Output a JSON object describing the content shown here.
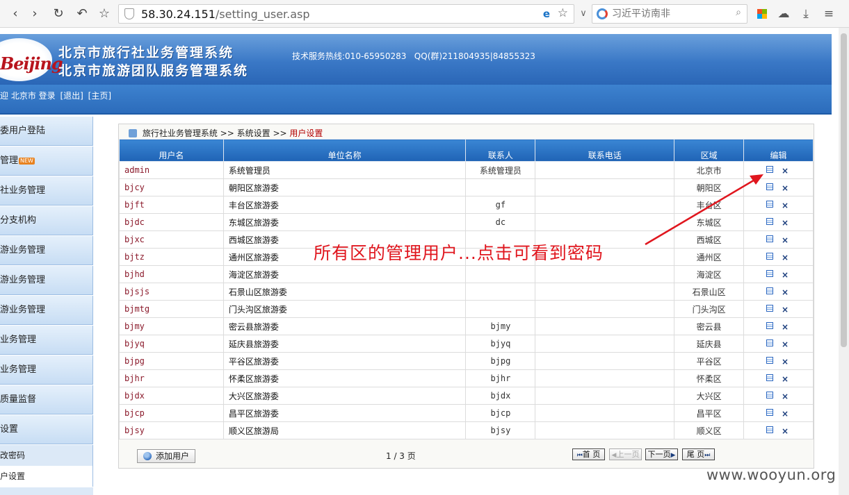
{
  "browser": {
    "url_host": "58.30.24.151",
    "url_path": "/setting_user.asp",
    "search_placeholder": "习近平访南非"
  },
  "header": {
    "logo": "Beijing",
    "title_line1": "北京市旅行社业务管理系统",
    "title_line2": "北京市旅游团队服务管理系统",
    "hotline": "技术服务热线:010-65950283   QQ(群)211804935|84855323",
    "welcome_prefix": "迎 北京市 登录",
    "logout_label": "[退出]",
    "home_label": "[主页]"
  },
  "sidebar": {
    "items": [
      {
        "label": "委用户登陆"
      },
      {
        "label": "管理",
        "badge": "NEW"
      },
      {
        "label": "社业务管理"
      },
      {
        "label": "分支机构"
      },
      {
        "label": "游业务管理"
      },
      {
        "label": "游业务管理"
      },
      {
        "label": "游业务管理"
      },
      {
        "label": "业务管理"
      },
      {
        "label": "业务管理"
      },
      {
        "label": "质量监督"
      },
      {
        "label": "设置"
      }
    ],
    "sub_items": [
      {
        "label": "改密码"
      },
      {
        "label": "户设置"
      }
    ]
  },
  "breadcrumb": {
    "root": "旅行社业务管理系统",
    "sep": ">>",
    "section": "系统设置",
    "current": "用户设置"
  },
  "table": {
    "headers": [
      "用户名",
      "单位名称",
      "联系人",
      "联系电话",
      "区域",
      "编辑"
    ],
    "rows": [
      {
        "user": "admin",
        "unit": "系统管理员",
        "contact": "系统管理员",
        "phone": "",
        "area": "北京市"
      },
      {
        "user": "bjcy",
        "unit": "朝阳区旅游委",
        "contact": "",
        "phone": "",
        "area": "朝阳区"
      },
      {
        "user": "bjft",
        "unit": "丰台区旅游委",
        "contact": "gf",
        "phone": "",
        "area": "丰台区"
      },
      {
        "user": "bjdc",
        "unit": "东城区旅游委",
        "contact": "dc",
        "phone": "",
        "area": "东城区"
      },
      {
        "user": "bjxc",
        "unit": "西城区旅游委",
        "contact": "",
        "phone": "",
        "area": "西城区"
      },
      {
        "user": "bjtz",
        "unit": "通州区旅游委",
        "contact": "",
        "phone": "",
        "area": "通州区"
      },
      {
        "user": "bjhd",
        "unit": "海淀区旅游委",
        "contact": "",
        "phone": "",
        "area": "海淀区"
      },
      {
        "user": "bjsjs",
        "unit": "石景山区旅游委",
        "contact": "",
        "phone": "",
        "area": "石景山区"
      },
      {
        "user": "bjmtg",
        "unit": "门头沟区旅游委",
        "contact": "",
        "phone": "",
        "area": "门头沟区"
      },
      {
        "user": "bjmy",
        "unit": "密云县旅游委",
        "contact": "bjmy",
        "phone": "",
        "area": "密云县"
      },
      {
        "user": "bjyq",
        "unit": "延庆县旅游委",
        "contact": "bjyq",
        "phone": "",
        "area": "延庆县"
      },
      {
        "user": "bjpg",
        "unit": "平谷区旅游委",
        "contact": "bjpg",
        "phone": "",
        "area": "平谷区"
      },
      {
        "user": "bjhr",
        "unit": "怀柔区旅游委",
        "contact": "bjhr",
        "phone": "",
        "area": "怀柔区"
      },
      {
        "user": "bjdx",
        "unit": "大兴区旅游委",
        "contact": "bjdx",
        "phone": "",
        "area": "大兴区"
      },
      {
        "user": "bjcp",
        "unit": "昌平区旅游委",
        "contact": "bjcp",
        "phone": "",
        "area": "昌平区"
      },
      {
        "user": "bjsy",
        "unit": "顺义区旅游局",
        "contact": "bjsy",
        "phone": "",
        "area": "顺义区"
      }
    ]
  },
  "footer": {
    "add_user_label": "添加用户",
    "page_info": "1 / 3 页",
    "first_label": "首 页",
    "prev_label": "上一页",
    "next_label": "下一页",
    "last_label": "尾 页"
  },
  "annotation": "所有区的管理用户...点击可看到密码",
  "watermark": "www.wooyun.org",
  "colors": {
    "banner_blue": "#3a78c6",
    "annotation_red": "#e0161e",
    "username_color": "#8b1a2b"
  }
}
